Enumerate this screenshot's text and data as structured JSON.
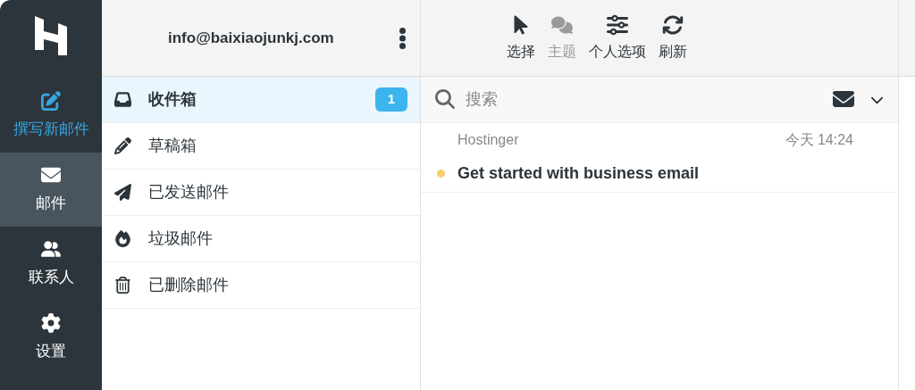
{
  "nav": [
    {
      "kind": "compose",
      "label": "撰写新邮件",
      "selected": false
    },
    {
      "kind": "mail",
      "label": "邮件",
      "selected": true
    },
    {
      "kind": "contacts",
      "label": "联系人",
      "selected": false
    },
    {
      "kind": "settings",
      "label": "设置",
      "selected": false
    }
  ],
  "account": {
    "email": "info@baixiaojunkj.com"
  },
  "folders": [
    {
      "kind": "inbox",
      "label": "收件箱",
      "selected": true,
      "badge": "1"
    },
    {
      "kind": "drafts",
      "label": "草稿箱",
      "selected": false
    },
    {
      "kind": "sent",
      "label": "已发送邮件",
      "selected": false
    },
    {
      "kind": "junk",
      "label": "垃圾邮件",
      "selected": false
    },
    {
      "kind": "trash",
      "label": "已删除邮件",
      "selected": false
    }
  ],
  "toolbar": [
    {
      "kind": "select",
      "label": "选择",
      "disabled": false
    },
    {
      "kind": "threads",
      "label": "主题",
      "disabled": true
    },
    {
      "kind": "options",
      "label": "个人选项",
      "disabled": false
    },
    {
      "kind": "refresh",
      "label": "刷新",
      "disabled": false
    }
  ],
  "search": {
    "placeholder": "搜索"
  },
  "messages": [
    {
      "sender": "Hostinger",
      "date": "今天 14:24",
      "subject": "Get started with business email",
      "unread": true,
      "color": "#f5d06a"
    }
  ]
}
